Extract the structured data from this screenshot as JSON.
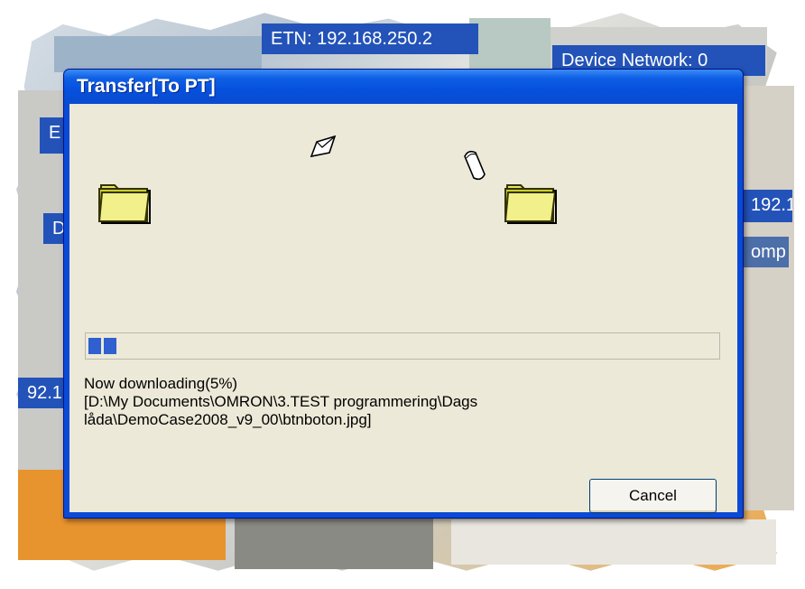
{
  "background": {
    "tags": [
      {
        "text": "ETN: 192.168.250.2"
      },
      {
        "text": "Device Network: 0"
      },
      {
        "text": "E"
      },
      {
        "text": "D"
      },
      {
        "text": "192.1"
      },
      {
        "text": "omp"
      },
      {
        "text": "92.1"
      }
    ]
  },
  "dialog": {
    "title": "Transfer[To PT]",
    "progress_percent": 5,
    "status_line": "Now downloading(5%)",
    "path_line_1": " [D:\\My Documents\\OMRON\\3.TEST programmering\\Dags",
    "path_line_2": "låda\\DemoCase2008_v9_00\\btnboton.jpg]",
    "cancel_label": "Cancel"
  },
  "colors": {
    "titlebar": "#0550dd",
    "client": "#ece9d8",
    "progress": "#2f5fd0",
    "tag": "#2353b8"
  },
  "icons": {
    "source": "folder-icon",
    "destination": "folder-icon",
    "flying_1": "flying-page-icon",
    "flying_2": "flying-page-icon"
  }
}
